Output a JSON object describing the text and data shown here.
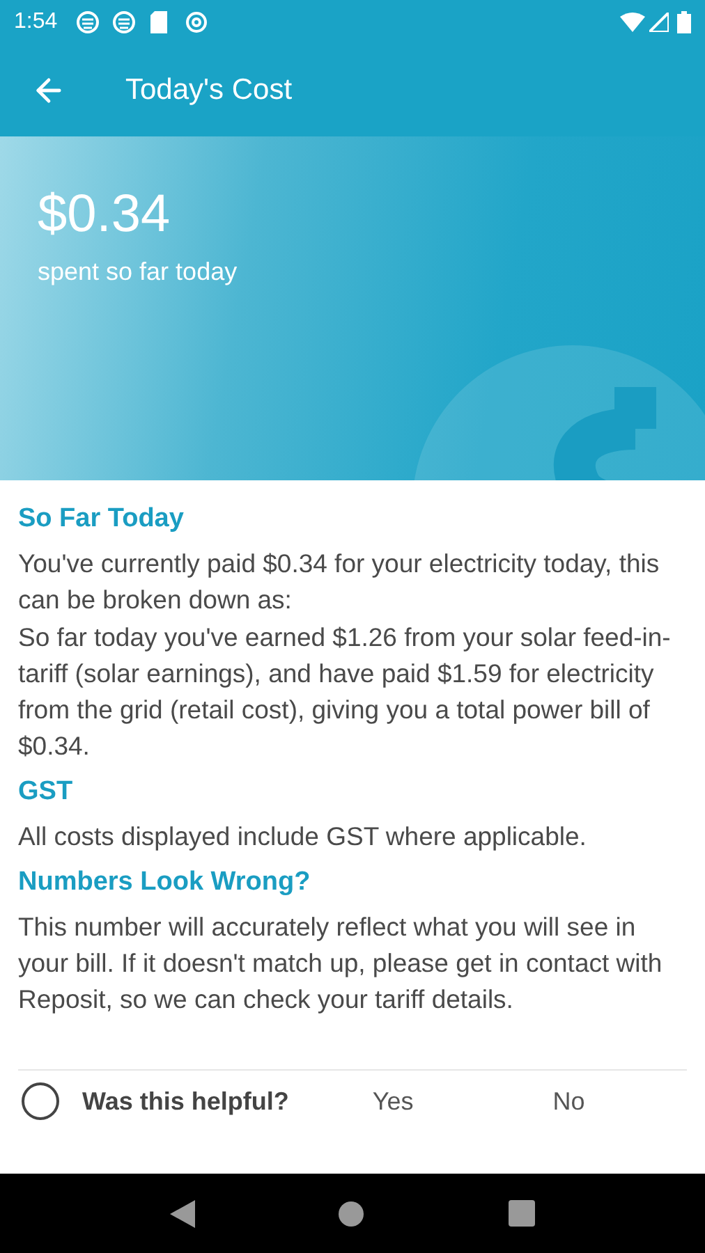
{
  "status_bar": {
    "time": "1:54"
  },
  "toolbar": {
    "title": "Today's Cost"
  },
  "hero": {
    "amount": "$0.34",
    "caption": "spent so far today"
  },
  "sections": [
    {
      "heading": "So Far Today",
      "paragraphs": [
        "You've currently paid $0.34 for your electricity today, this can be broken down as:",
        "So far today you've earned $1.26 from your solar feed-in-tariff (solar earnings), and have paid $1.59 for electricity from the grid (retail cost), giving you a total power bill of $0.34."
      ]
    },
    {
      "heading": "GST",
      "paragraphs": [
        "All costs displayed include GST where applicable."
      ]
    },
    {
      "heading": "Numbers Look Wrong?",
      "paragraphs": [
        "This number will accurately reflect what you will see in your bill. If it doesn't match up, please get in contact with Reposit, so we can check your tariff details."
      ]
    }
  ],
  "feedback": {
    "question": "Was this helpful?",
    "options": [
      "Yes",
      "No"
    ]
  }
}
